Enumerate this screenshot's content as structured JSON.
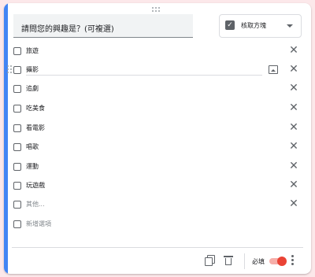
{
  "question": {
    "title": "請問您的興趣是？(可複選)"
  },
  "type_selector": {
    "label": "核取方塊",
    "check_icon": "check-box-icon",
    "caret_icon": "arrow-drop-down-icon"
  },
  "options": [
    {
      "label": "旅遊",
      "removable": true
    },
    {
      "label": "攝影",
      "removable": true,
      "editing": true
    },
    {
      "label": "追劇",
      "removable": true
    },
    {
      "label": "吃美食",
      "removable": true
    },
    {
      "label": "看電影",
      "removable": true
    },
    {
      "label": "唱歌",
      "removable": true
    },
    {
      "label": "運動",
      "removable": true
    },
    {
      "label": "玩遊戲",
      "removable": true
    },
    {
      "label": "其他...",
      "removable": true
    }
  ],
  "add_option": {
    "label": "新增選項"
  },
  "footer": {
    "required_label": "必填",
    "required_on": true,
    "icons": [
      "copy-icon",
      "trash-icon",
      "more-vert-icon"
    ]
  },
  "colors": {
    "accent": "#4285f4",
    "toggle": "#ea4335",
    "background": "#fce8ea"
  }
}
